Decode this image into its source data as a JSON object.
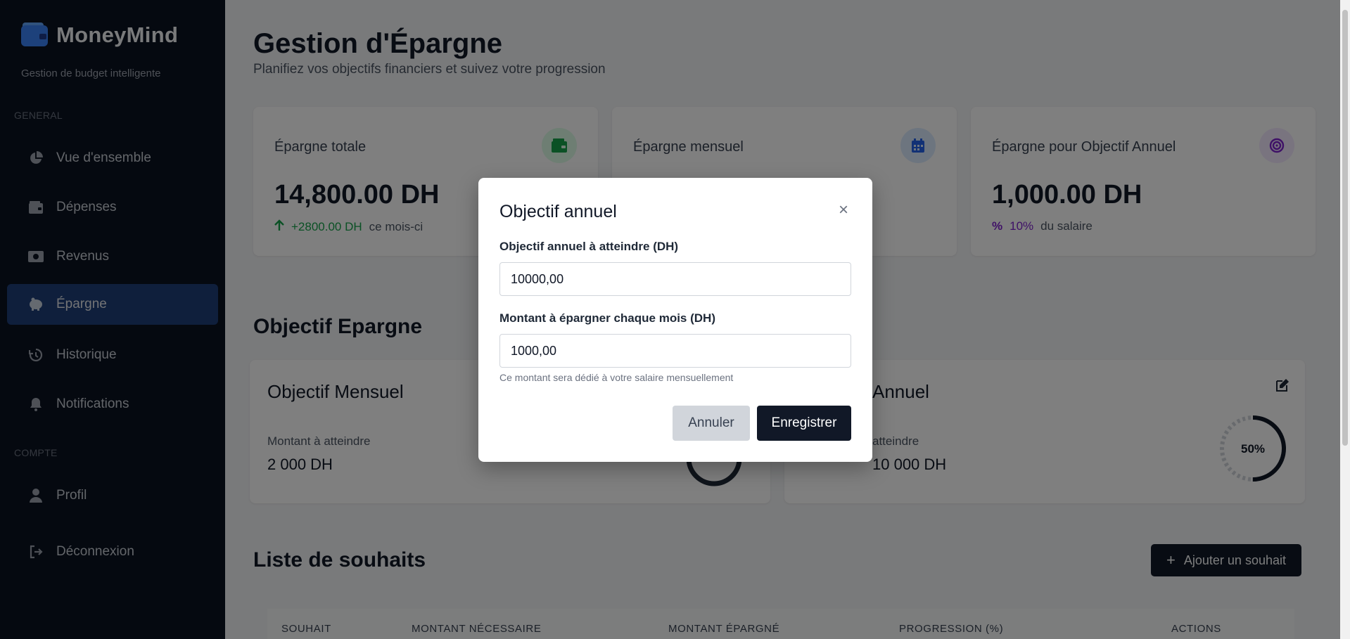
{
  "brand": {
    "name": "MoneyMind",
    "tagline": "Gestion de budget intelligente"
  },
  "sidebar": {
    "section_general": "GENERAL",
    "section_compte": "COMPTE",
    "items": [
      {
        "label": "Vue d'ensemble",
        "icon": "pie-chart-icon"
      },
      {
        "label": "Dépenses",
        "icon": "wallet-icon"
      },
      {
        "label": "Revenus",
        "icon": "money-bill-icon"
      },
      {
        "label": "Épargne",
        "icon": "piggy-bank-icon",
        "active": true
      },
      {
        "label": "Historique",
        "icon": "history-icon"
      },
      {
        "label": "Notifications",
        "icon": "bell-icon"
      },
      {
        "label": "Profil",
        "icon": "user-icon"
      },
      {
        "label": "Déconnexion",
        "icon": "logout-icon"
      }
    ]
  },
  "header": {
    "title": "Gestion d'Épargne",
    "subtitle": "Planifiez vos objectifs financiers et suivez votre progression"
  },
  "stats": [
    {
      "label": "Épargne totale",
      "value": "14,800.00 DH",
      "delta_value": "+2800.00 DH",
      "delta_text": "ce mois-ci",
      "icon": "wallet-icon",
      "accent": "#16a34a"
    },
    {
      "label": "Épargne mensuel",
      "value": "",
      "delta_value": "",
      "delta_text": "",
      "icon": "calendar-icon",
      "accent": "#2563eb"
    },
    {
      "label": "Épargne pour Objectif Annuel",
      "value": "1,000.00 DH",
      "delta_value": "10%",
      "delta_text": "du salaire",
      "icon": "target-icon",
      "accent": "#7e22ce"
    }
  ],
  "goals": {
    "section_title": "Objectif Epargne",
    "monthly": {
      "title": "Objectif Mensuel",
      "label": "Montant à atteindre",
      "value": "2 000 DH"
    },
    "annual": {
      "title": "Annuel",
      "label": "atteindre",
      "value": "10 000 DH",
      "progress_label": "50%",
      "progress": 0.5
    }
  },
  "wishlist": {
    "title": "Liste de souhaits",
    "add_button": "Ajouter un souhait",
    "columns": [
      "SOUHAIT",
      "MONTANT NÉCESSAIRE",
      "MONTANT ÉPARGNÉ",
      "PROGRESSION (%)",
      "ACTIONS"
    ]
  },
  "modal": {
    "title": "Objectif annuel",
    "close": "×",
    "field1_label": "Objectif annuel à atteindre (DH)",
    "field1_value": "10000,00",
    "field2_label": "Montant à épargner chaque mois (DH)",
    "field2_value": "1000,00",
    "hint": "Ce montant sera dédié à votre salaire mensuellement",
    "cancel": "Annuler",
    "save": "Enregistrer"
  },
  "colors": {
    "sidebar_bg": "#0b1221",
    "active_bg": "#1e3f79",
    "primary_dark": "#111827",
    "brand_blue": "#3b82f6"
  }
}
